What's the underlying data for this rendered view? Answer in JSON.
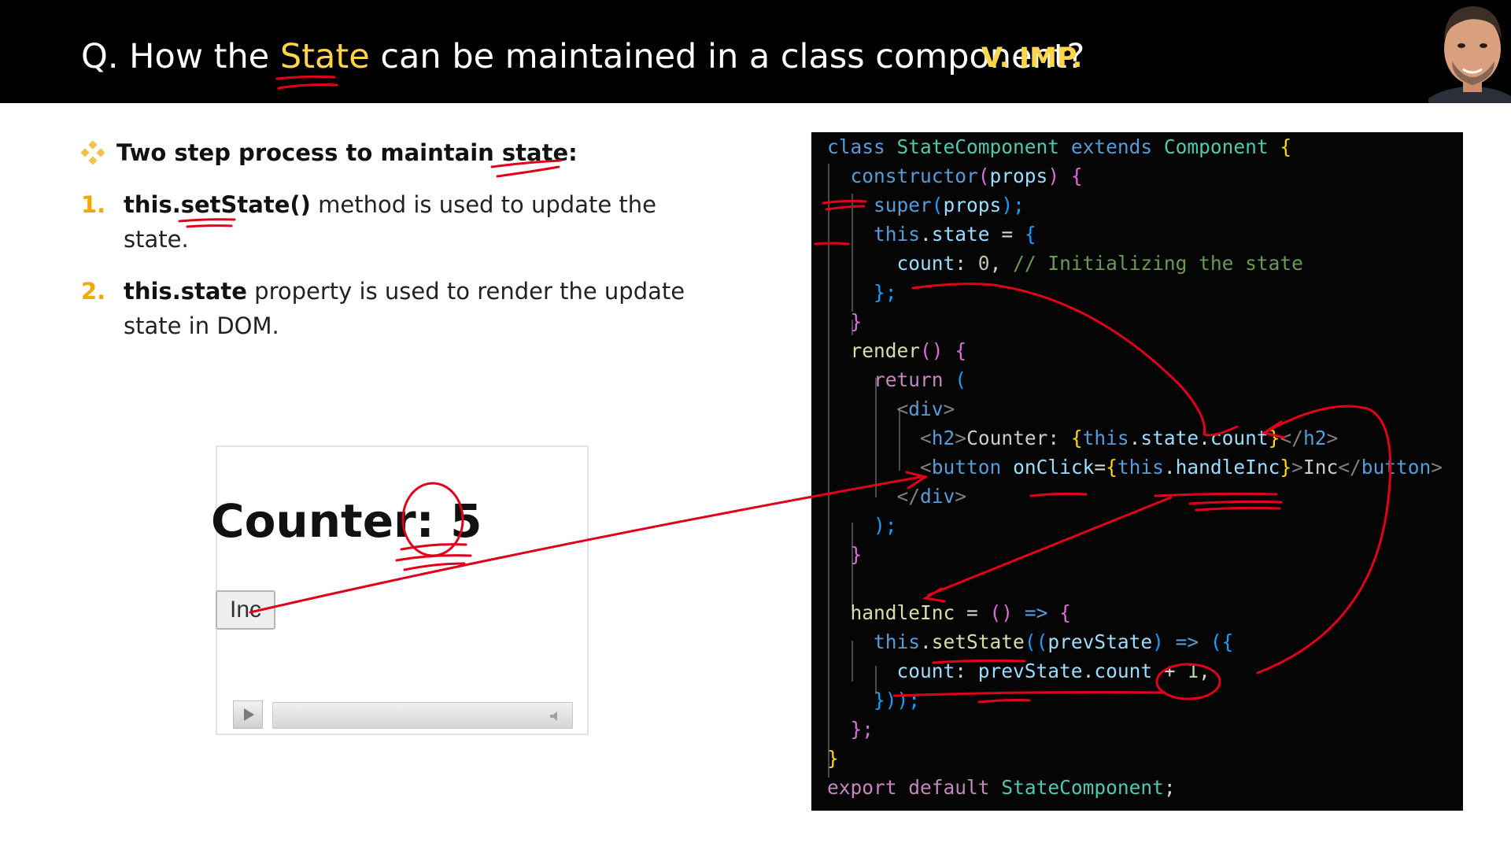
{
  "header": {
    "question_prefix": "Q. How the ",
    "question_highlight": "State",
    "question_suffix": " can be maintained in a class component?",
    "importance": "V. IMP."
  },
  "colors": {
    "header_bg": "#000000",
    "accent_yellow": "#ffd54a",
    "number_orange": "#f2a900",
    "annotation_red": "#e0001b",
    "code_bg": "#050505"
  },
  "content": {
    "heading": "Two step process to maintain state:",
    "items": [
      {
        "number": "1.",
        "bold": "this.setState()",
        "rest": " method is used to update the state."
      },
      {
        "number": "2.",
        "bold": "this.state",
        "rest": " property is used to render the update state in DOM."
      }
    ]
  },
  "demo": {
    "counter_label": "Counter:",
    "counter_value": "5",
    "button_label": "Inc",
    "player_icons": [
      "play-icon",
      "volume-icon"
    ]
  },
  "code": {
    "l1": {
      "a": "class",
      "b": "StateComponent",
      "c": "extends",
      "d": "Component",
      "e": "{"
    },
    "l2": {
      "a": "constructor",
      "b": "(",
      "c": "props",
      "d": ")",
      "e": "{"
    },
    "l3": {
      "a": "super",
      "b": "(",
      "c": "props",
      "d": ");"
    },
    "l4": {
      "a": "this",
      "b": ".",
      "c": "state",
      "d": " = ",
      "e": "{"
    },
    "l5": {
      "a": "count",
      "b": ": ",
      "c": "0",
      "d": ", ",
      "e": "// Initializing the state"
    },
    "l6": {
      "a": "};"
    },
    "l7": {
      "a": "}"
    },
    "l8": {
      "a": "render",
      "b": "()",
      "c": "{"
    },
    "l9": {
      "a": "return",
      "b": "("
    },
    "l10": {
      "a": "<",
      "b": "div",
      "c": ">"
    },
    "l11": {
      "a": "<",
      "b": "h2",
      "c": ">",
      "d": "Counter: ",
      "e": "{",
      "f": "this",
      "g": ".",
      "h": "state",
      "i": ".",
      "j": "count",
      "k": "}",
      "l": "</",
      "m": "h2",
      "n": ">"
    },
    "l12": {
      "a": "<",
      "b": "button",
      "c": "onClick",
      "d": "=",
      "e": "{",
      "f": "this",
      "g": ".",
      "h": "handleInc",
      "i": "}",
      "j": ">",
      "k": "Inc",
      "l": "</",
      "m": "button",
      "n": ">"
    },
    "l13": {
      "a": "</",
      "b": "div",
      "c": ">"
    },
    "l14": {
      "a": ");"
    },
    "l15": {
      "a": "}"
    },
    "l16": {
      "a": "handleInc",
      "b": " = ",
      "c": "()",
      "d": " => ",
      "e": "{"
    },
    "l17": {
      "a": "this",
      "b": ".",
      "c": "setState",
      "d": "((",
      "e": "prevState",
      "f": ")",
      "g": " => ",
      "h": "({"
    },
    "l18": {
      "a": "count",
      "b": ": ",
      "c": "prevState",
      "d": ".",
      "e": "count",
      "f": " + ",
      "g": "1",
      "h": ","
    },
    "l19": {
      "a": "}));"
    },
    "l20": {
      "a": "};"
    },
    "l21": {
      "a": "}"
    },
    "l22": {
      "a": "export",
      "b": "default",
      "c": "StateComponent",
      "d": ";"
    }
  }
}
